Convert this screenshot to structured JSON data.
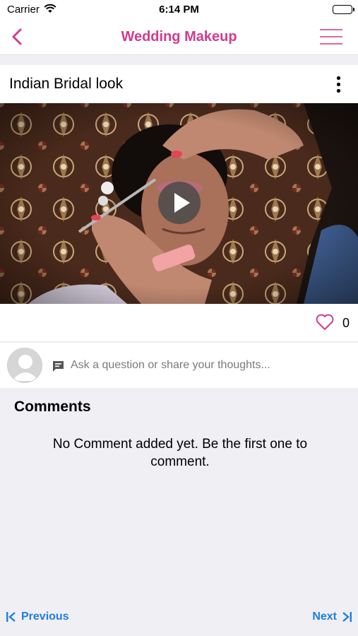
{
  "status_bar": {
    "carrier": "Carrier",
    "time": "6:14 PM"
  },
  "nav": {
    "title": "Wedding Makeup",
    "back_icon": "chevron-left-icon",
    "menu_icon": "hamburger-menu-icon",
    "accent": "#d33a8f"
  },
  "post": {
    "title": "Indian Bridal look",
    "video": {
      "play_icon": "play-icon"
    },
    "likes": {
      "count": "0",
      "icon": "heart-outline-icon",
      "color": "#d33a8f"
    }
  },
  "comment_input": {
    "placeholder": "Ask a question or share your thoughts...",
    "icon": "comment-icon"
  },
  "comments": {
    "heading": "Comments",
    "empty_message": "No Comment added yet. Be the first one to comment."
  },
  "footer": {
    "previous_label": "Previous",
    "next_label": "Next",
    "link_color": "#1f7fe0"
  }
}
